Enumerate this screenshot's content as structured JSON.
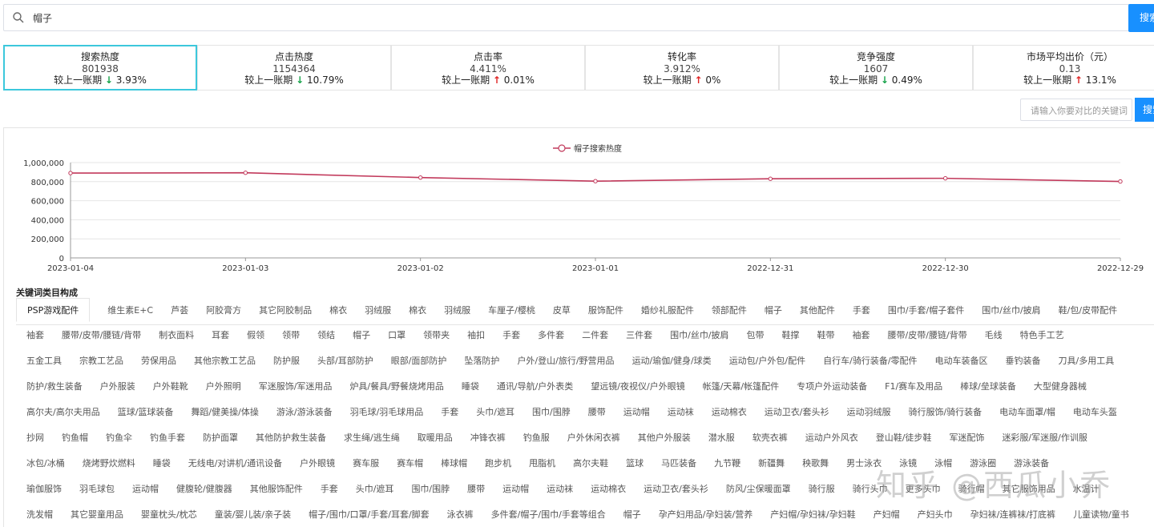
{
  "search": {
    "query": "帽子",
    "button_label": "搜索"
  },
  "metrics": [
    {
      "name": "搜索热度",
      "value": "801938",
      "compare_label": "较上一账期",
      "direction": "down",
      "change": "3.93%"
    },
    {
      "name": "点击热度",
      "value": "1154364",
      "compare_label": "较上一账期",
      "direction": "down",
      "change": "10.79%"
    },
    {
      "name": "点击率",
      "value": "4.411%",
      "compare_label": "较上一账期",
      "direction": "up",
      "change": "0.01%"
    },
    {
      "name": "转化率",
      "value": "3.912%",
      "compare_label": "较上一账期",
      "direction": "up",
      "change": "0%"
    },
    {
      "name": "竞争强度",
      "value": "1607",
      "compare_label": "较上一账期",
      "direction": "down",
      "change": "0.49%"
    },
    {
      "name": "市场平均出价（元）",
      "value": "0.13",
      "compare_label": "较上一账期",
      "direction": "up",
      "change": "13.1%"
    }
  ],
  "compare": {
    "placeholder": "请输入你要对比的关键词",
    "button_label": "搜索"
  },
  "colors": {
    "accent": "#1890ff",
    "active_border": "#3cc8dc",
    "up": "#e02424",
    "down": "#17a34a",
    "series": "#c23a5c"
  },
  "chart_data": {
    "type": "line",
    "legend_position": "top-center",
    "grid": true,
    "x": [
      "2023-01-04",
      "2023-01-03",
      "2023-01-02",
      "2023-01-01",
      "2022-12-31",
      "2022-12-30",
      "2022-12-29"
    ],
    "series": [
      {
        "name": "帽子搜索热度",
        "values": [
          890000,
          893000,
          843000,
          805000,
          830000,
          835000,
          801938
        ]
      }
    ],
    "ylim": [
      0,
      1000000
    ],
    "yticks": [
      "0",
      "200,000",
      "400,000",
      "600,000",
      "800,000",
      "1,000,000"
    ]
  },
  "categories": {
    "title": "关键词类目构成",
    "rows": [
      [
        "PSP游戏配件",
        "维生素E+C",
        "芦荟",
        "阿胶膏方",
        "其它阿胶制品",
        "棉衣",
        "羽绒服",
        "棉衣",
        "羽绒服",
        "车厘子/樱桃",
        "皮草",
        "服饰配件",
        "婚纱礼服配件",
        "领部配件",
        "帽子",
        "其他配件",
        "手套",
        "围巾/手套/帽子套件",
        "围巾/丝巾/披肩",
        "鞋/包/皮带配件"
      ],
      [
        "袖套",
        "腰带/皮带/腰链/背带",
        "制衣面料",
        "耳套",
        "假领",
        "领带",
        "领结",
        "帽子",
        "口罩",
        "领带夹",
        "袖扣",
        "手套",
        "多件套",
        "二件套",
        "三件套",
        "围巾/丝巾/披肩",
        "包带",
        "鞋撑",
        "鞋带",
        "袖套",
        "腰带/皮带/腰链/背带",
        "毛线",
        "特色手工艺"
      ],
      [
        "五金工具",
        "宗教工艺品",
        "劳保用品",
        "其他宗教工艺品",
        "防护服",
        "头部/耳部防护",
        "眼部/面部防护",
        "坠落防护",
        "户外/登山/旅行/野营用品",
        "运动/瑜伽/健身/球类",
        "运动包/户外包/配件",
        "自行车/骑行装备/零配件",
        "电动车装备区",
        "垂钓装备",
        "刀具/多用工具"
      ],
      [
        "防护/救生装备",
        "户外服装",
        "户外鞋靴",
        "户外照明",
        "军迷服饰/军迷用品",
        "炉具/餐具/野餐烧烤用品",
        "睡袋",
        "通讯/导航/户外表类",
        "望远镜/夜视仪/户外眼镜",
        "帐篷/天幕/帐篷配件",
        "专项户外运动装备",
        "F1/赛车及用品",
        "棒球/垒球装备",
        "大型健身器械"
      ],
      [
        "高尔夫/高尔夫用品",
        "篮球/篮球装备",
        "舞蹈/健美操/体操",
        "游泳/游泳装备",
        "羽毛球/羽毛球用品",
        "手套",
        "头巾/遮耳",
        "围巾/围脖",
        "腰带",
        "运动帽",
        "运动袜",
        "运动棉衣",
        "运动卫衣/套头衫",
        "运动羽绒服",
        "骑行服饰/骑行装备",
        "电动车面罩/帽",
        "电动车头盔"
      ],
      [
        "抄网",
        "钓鱼帽",
        "钓鱼伞",
        "钓鱼手套",
        "防护面罩",
        "其他防护救生装备",
        "求生绳/逃生绳",
        "取暖用品",
        "冲锋衣裤",
        "钓鱼服",
        "户外休闲衣裤",
        "其他户外服装",
        "潜水服",
        "软壳衣裤",
        "运动户外风衣",
        "登山鞋/徒步鞋",
        "军迷配饰",
        "迷彩服/军迷服/作训服"
      ],
      [
        "冰包/冰桶",
        "烧烤野炊燃料",
        "睡袋",
        "无线电/对讲机/通讯设备",
        "户外眼镜",
        "赛车服",
        "赛车帽",
        "棒球帽",
        "跑步机",
        "甩脂机",
        "高尔夫鞋",
        "篮球",
        "马匹装备",
        "九节鞭",
        "新疆舞",
        "秧歌舞",
        "男士泳衣",
        "泳镜",
        "泳帽",
        "游泳圈",
        "游泳装备"
      ],
      [
        "瑜伽服饰",
        "羽毛球包",
        "运动帽",
        "健腹轮/健腹器",
        "其他服饰配件",
        "手套",
        "头巾/遮耳",
        "围巾/围脖",
        "腰带",
        "运动帽",
        "运动袜",
        "运动棉衣",
        "运动卫衣/套头衫",
        "防风/尘保暖面罩",
        "骑行服",
        "骑行头巾",
        "更多头巾",
        "骑行帽",
        "其它服饰用品",
        "水温计"
      ],
      [
        "洗发帽",
        "其它婴童用品",
        "婴童枕头/枕芯",
        "童装/婴儿装/亲子装",
        "帽子/围巾/口罩/手套/耳套/脚套",
        "泳衣裤",
        "多件套/帽子/围巾/手套等组合",
        "帽子",
        "孕产妇用品/孕妇装/营养",
        "产妇帽/孕妇袜/孕妇鞋",
        "产妇帽",
        "产妇头巾",
        "孕妇袜/连裤袜/打底裤",
        "儿童读物/童书"
      ]
    ]
  },
  "watermark": "知乎 @西瓜小乔"
}
